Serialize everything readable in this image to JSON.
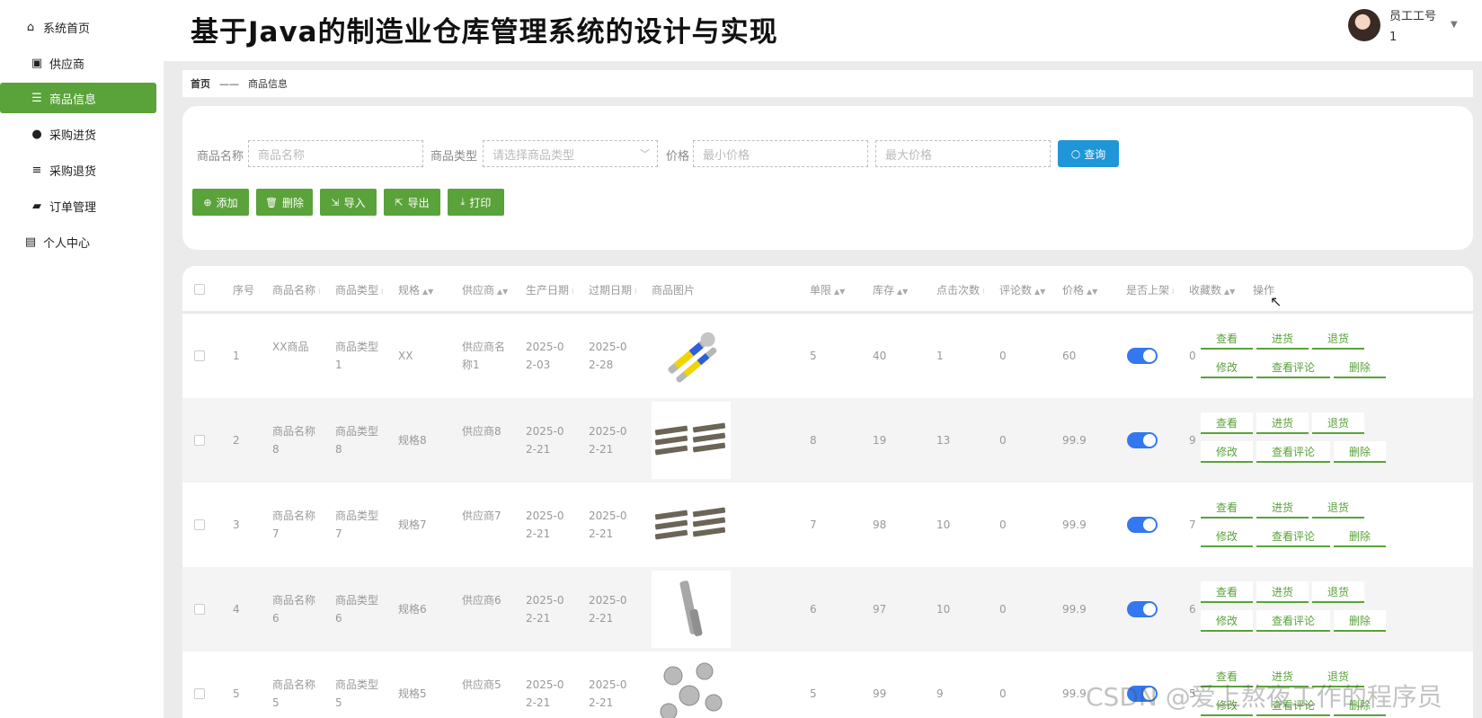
{
  "sidebar": {
    "items": [
      {
        "label": "系统首页",
        "icon": "home-icon"
      },
      {
        "label": "供应商",
        "icon": "clipboard-icon"
      },
      {
        "label": "商品信息",
        "icon": "sliders-icon",
        "active": true
      },
      {
        "label": "采购进货",
        "icon": "pin-icon"
      },
      {
        "label": "采购退货",
        "icon": "list-icon"
      },
      {
        "label": "订单管理",
        "icon": "ticket-icon"
      },
      {
        "label": "个人中心",
        "icon": "card-icon"
      }
    ]
  },
  "header": {
    "title": "基于Java的制造业仓库管理系统的设计与实现",
    "user_name": "员工工号",
    "user_id": "1"
  },
  "breadcrumb": {
    "home": "首页",
    "separator": "——",
    "current": "商品信息"
  },
  "search": {
    "name_label": "商品名称",
    "name_placeholder": "商品名称",
    "type_label": "商品类型",
    "type_placeholder": "请选择商品类型",
    "price_label": "价格",
    "min_placeholder": "最小价格",
    "max_placeholder": "最大价格",
    "query_label": "查询"
  },
  "toolbar": {
    "add": "添加",
    "delete": "删除",
    "import": "导入",
    "export": "导出",
    "print": "打印"
  },
  "table": {
    "headers": [
      "序号",
      "商品名称",
      "商品类型",
      "规格",
      "供应商",
      "生产日期",
      "过期日期",
      "商品图片",
      "单限",
      "库存",
      "点击次数",
      "评论数",
      "价格",
      "是否上架",
      "收藏数",
      "操作"
    ],
    "actions": {
      "view": "查看",
      "stock_in": "进货",
      "return": "退货",
      "edit": "修改",
      "view_comments": "查看评论",
      "delete": "删除"
    },
    "rows": [
      {
        "no": "1",
        "name": "XX商品",
        "type": "商品类型1",
        "spec": "XX",
        "supplier": "供应商名称1",
        "prod_date": "2025-02-03",
        "exp_date": "2025-02-28",
        "image": "wrench-set",
        "limit": "5",
        "stock": "40",
        "clicks": "1",
        "comments": "0",
        "price": "60",
        "on_sale": true,
        "favorites": "0"
      },
      {
        "no": "2",
        "name": "商品名称8",
        "type": "商品类型8",
        "spec": "规格8",
        "supplier": "供应商8",
        "prod_date": "2025-02-21",
        "exp_date": "2025-02-21",
        "image": "metal-strips",
        "limit": "8",
        "stock": "19",
        "clicks": "13",
        "comments": "0",
        "price": "99.9",
        "on_sale": true,
        "favorites": "9"
      },
      {
        "no": "3",
        "name": "商品名称7",
        "type": "商品类型7",
        "spec": "规格7",
        "supplier": "供应商7",
        "prod_date": "2025-02-21",
        "exp_date": "2025-02-21",
        "image": "metal-strips",
        "limit": "7",
        "stock": "98",
        "clicks": "10",
        "comments": "0",
        "price": "99.9",
        "on_sale": true,
        "favorites": "7"
      },
      {
        "no": "4",
        "name": "商品名称6",
        "type": "商品类型6",
        "spec": "规格6",
        "supplier": "供应商6",
        "prod_date": "2025-02-21",
        "exp_date": "2025-02-21",
        "image": "hinge",
        "limit": "6",
        "stock": "97",
        "clicks": "10",
        "comments": "0",
        "price": "99.9",
        "on_sale": true,
        "favorites": "6"
      },
      {
        "no": "5",
        "name": "商品名称5",
        "type": "商品类型5",
        "spec": "规格5",
        "supplier": "供应商5",
        "prod_date": "2025-02-21",
        "exp_date": "2025-02-21",
        "image": "fittings",
        "limit": "5",
        "stock": "99",
        "clicks": "9",
        "comments": "0",
        "price": "99.9",
        "on_sale": true,
        "favorites": "5"
      }
    ]
  },
  "watermark": "CSDN @爱上熬夜工作的程序员",
  "colors": {
    "accent": "#5aa23a",
    "query": "#1e96d8",
    "toggle": "#3478f0"
  }
}
